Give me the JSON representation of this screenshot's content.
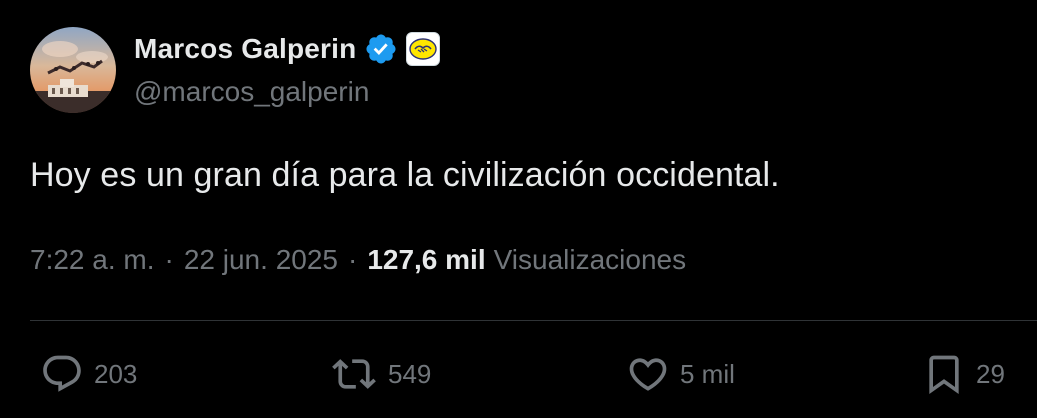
{
  "author": {
    "display_name": "Marcos Galperin",
    "handle": "@marcos_galperin",
    "verified": true,
    "verified_color": "#1d9bf0",
    "affiliate_badge": "handshake-logo-icon",
    "affiliate_badge_color": "#ffe600"
  },
  "tweet": {
    "text": "Hoy es un gran día para la civilización occidental.",
    "time": "7:22 a. m.",
    "separator": "·",
    "date": "22 jun. 2025",
    "views_count": "127,6 mil",
    "views_label": "Visualizaciones"
  },
  "actions": {
    "reply": {
      "icon": "reply-icon",
      "count": "203"
    },
    "retweet": {
      "icon": "retweet-icon",
      "count": "549"
    },
    "like": {
      "icon": "heart-icon",
      "count": "5 mil"
    },
    "bookmark": {
      "icon": "bookmark-icon",
      "count": "29"
    }
  },
  "colors": {
    "background": "#000000",
    "primary_text": "#e7e9ea",
    "secondary_text": "#71767b",
    "divider": "#2f3336"
  }
}
